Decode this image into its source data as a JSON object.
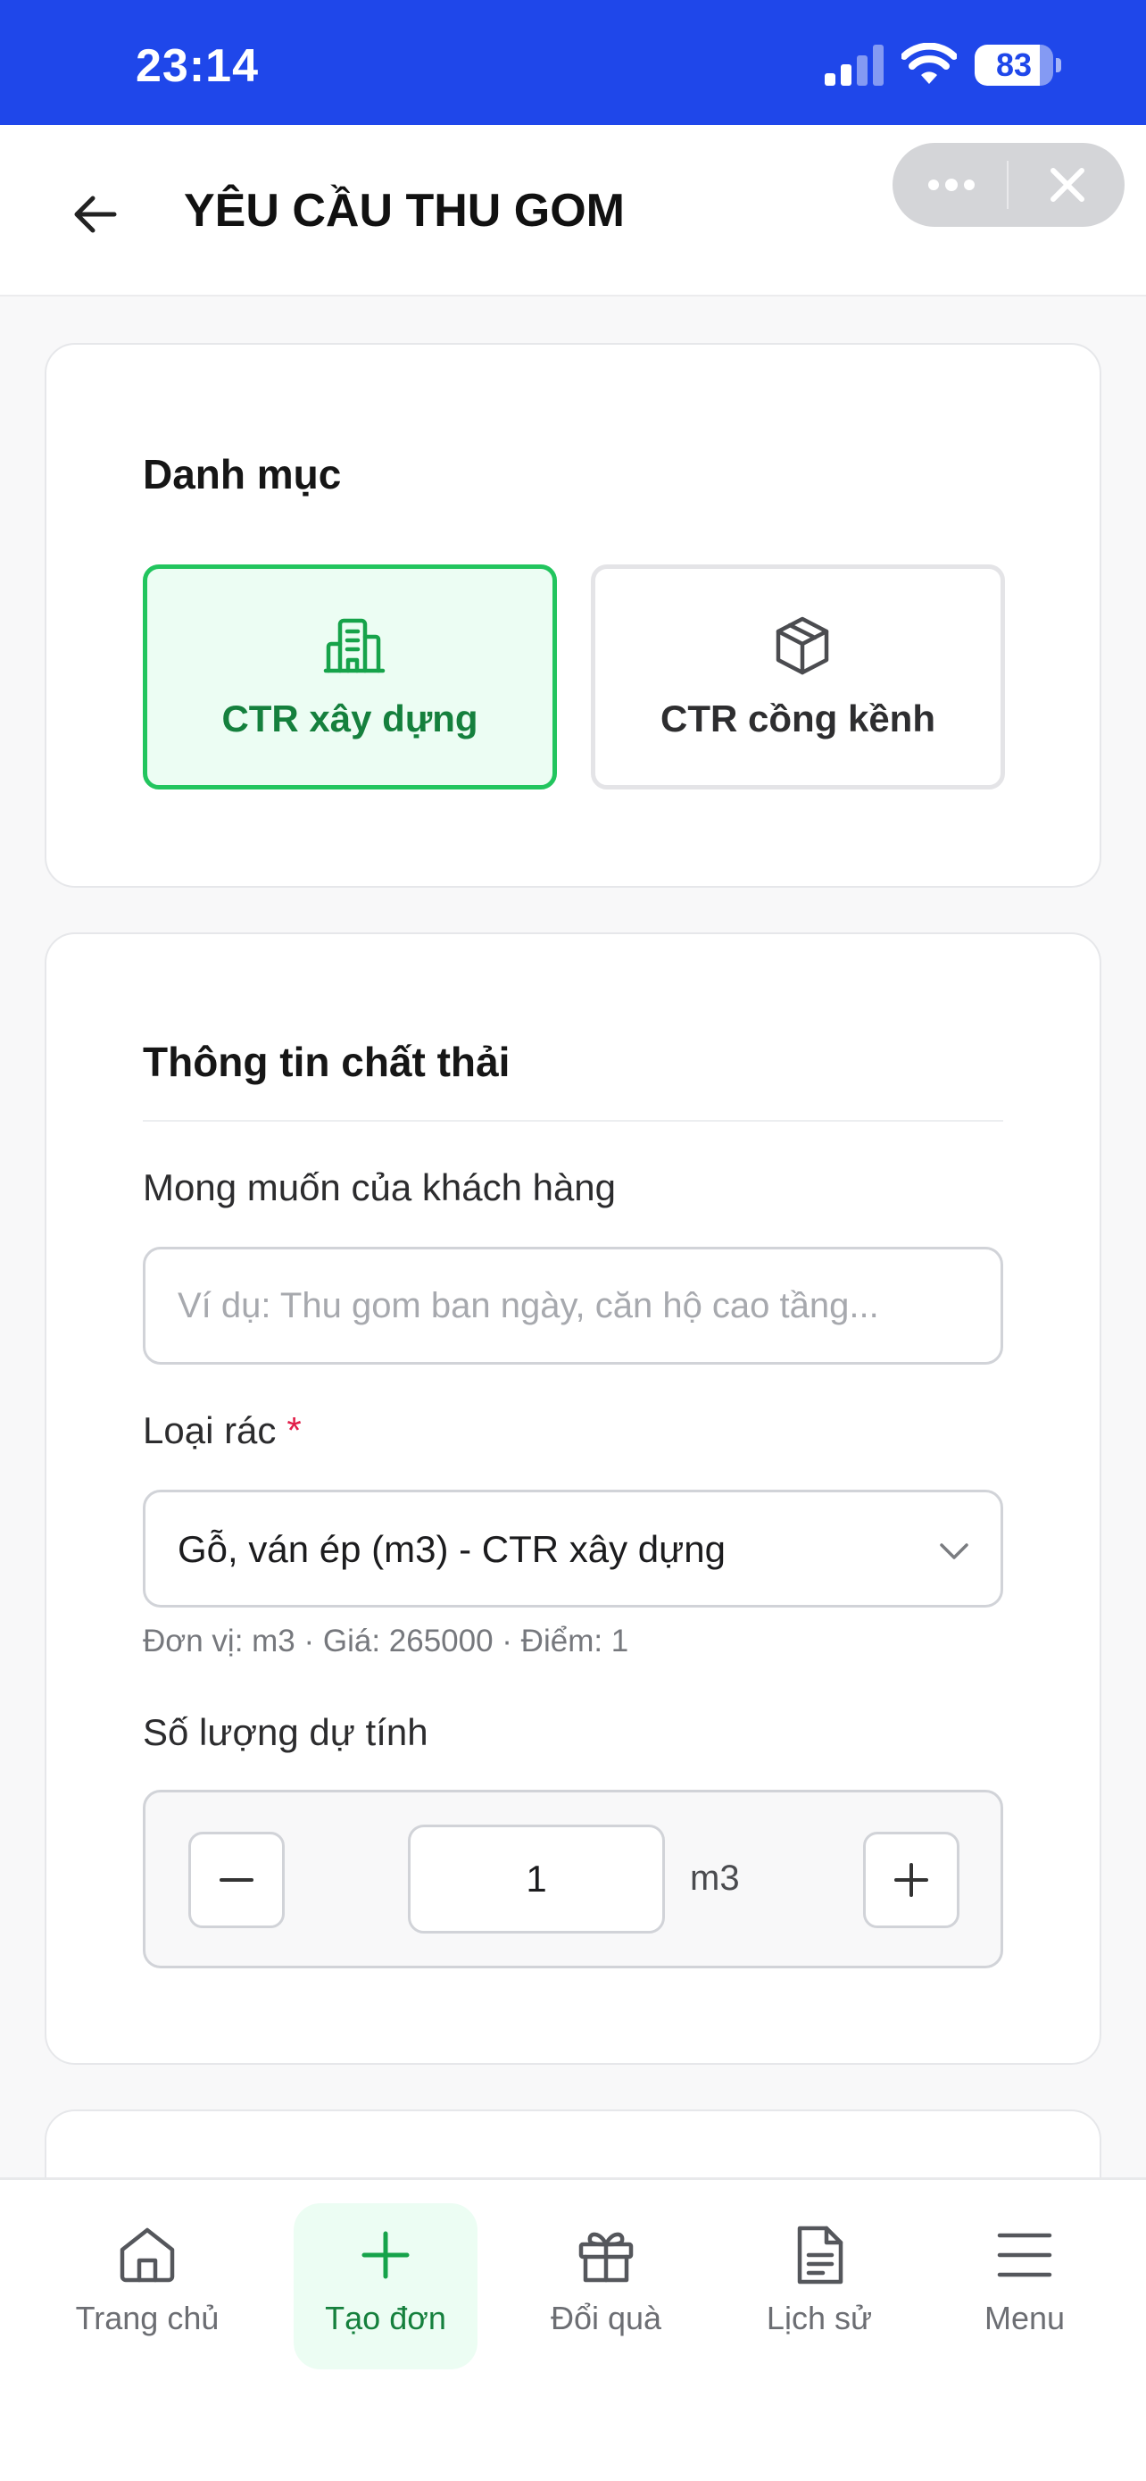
{
  "status_bar": {
    "time": "23:14",
    "battery": "83",
    "battery_level_percent": 83
  },
  "header": {
    "title": "YÊU CẦU THU GOM"
  },
  "category": {
    "title": "Danh mục",
    "options": [
      {
        "label": "CTR xây dựng",
        "icon": "building-icon",
        "selected": true
      },
      {
        "label": "CTR cồng kềnh",
        "icon": "package-icon",
        "selected": false
      }
    ]
  },
  "waste_info": {
    "title": "Thông tin chất thải",
    "wish_label": "Mong muốn của khách hàng",
    "wish_value": "",
    "wish_placeholder": "Ví dụ: Thu gom ban ngày, căn hộ cao tầng...",
    "type_label": "Loại rác",
    "type_required": "*",
    "type_value": "Gỗ, ván ép (m3) - CTR xây dựng",
    "type_helper": "Đơn vị: m3 · Giá: 265000 · Điểm: 1",
    "qty_label": "Số lượng dự tính",
    "qty_value": "1",
    "qty_unit": "m3"
  },
  "colors": {
    "status_bar": "#1f47ea",
    "accent": "#22c55e",
    "accent_text": "#15803d",
    "accent_bg": "#ecfdf3",
    "required": "#e11d48"
  },
  "bottom_nav": [
    {
      "label": "Trang chủ",
      "icon": "home-icon",
      "active": false
    },
    {
      "label": "Tạo đơn",
      "icon": "plus-icon",
      "active": true
    },
    {
      "label": "Đổi quà",
      "icon": "gift-icon",
      "active": false
    },
    {
      "label": "Lịch sử",
      "icon": "document-icon",
      "active": false
    },
    {
      "label": "Menu",
      "icon": "menu-icon",
      "active": false
    }
  ]
}
